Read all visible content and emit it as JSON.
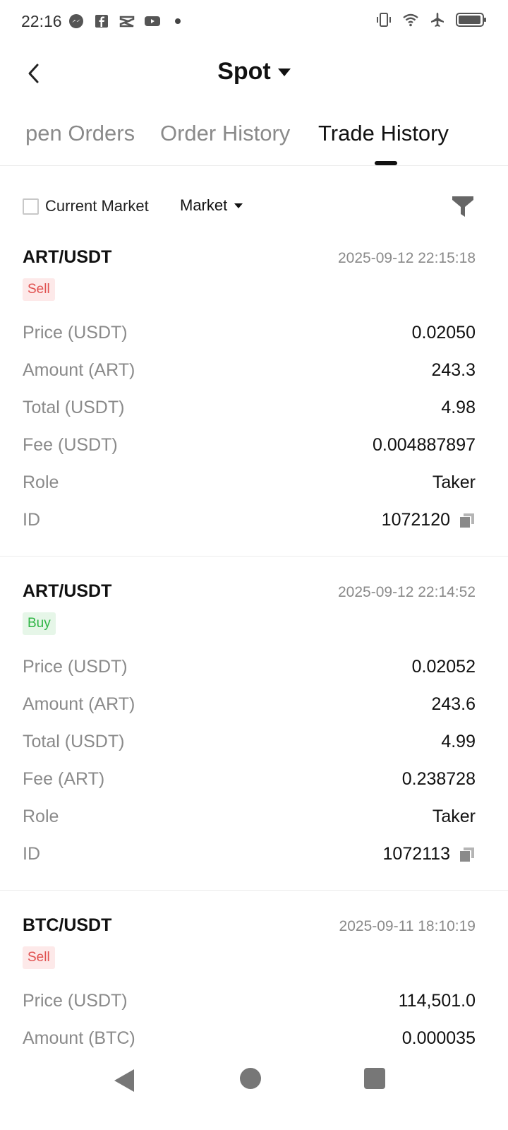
{
  "status_bar": {
    "time": "22:16",
    "left_icons": [
      "messenger-icon",
      "facebook-icon",
      "capcut-icon",
      "youtube-icon",
      "notification-dot"
    ],
    "right_icons": [
      "vibrate-icon",
      "wifi-icon",
      "airplane-icon",
      "battery-icon"
    ]
  },
  "header": {
    "title": "Spot"
  },
  "tabs": [
    {
      "label": "Open Orders",
      "visible_text": "pen Orders",
      "active": false
    },
    {
      "label": "Order History",
      "active": false
    },
    {
      "label": "Trade History",
      "active": true
    }
  ],
  "filters": {
    "current_market_label": "Current Market",
    "current_market_checked": false,
    "market_dropdown_label": "Market"
  },
  "trades": [
    {
      "pair": "ART/USDT",
      "time": "2025-09-12 22:15:18",
      "side": "Sell",
      "rows": [
        {
          "label": "Price (USDT)",
          "value": "0.02050"
        },
        {
          "label": "Amount (ART)",
          "value": "243.3"
        },
        {
          "label": "Total (USDT)",
          "value": "4.98"
        },
        {
          "label": "Fee (USDT)",
          "value": "0.004887897"
        },
        {
          "label": "Role",
          "value": "Taker"
        },
        {
          "label": "ID",
          "value": "1072120"
        }
      ]
    },
    {
      "pair": "ART/USDT",
      "time": "2025-09-12 22:14:52",
      "side": "Buy",
      "rows": [
        {
          "label": "Price (USDT)",
          "value": "0.02052"
        },
        {
          "label": "Amount (ART)",
          "value": "243.6"
        },
        {
          "label": "Total (USDT)",
          "value": "4.99"
        },
        {
          "label": "Fee (ART)",
          "value": "0.238728"
        },
        {
          "label": "Role",
          "value": "Taker"
        },
        {
          "label": "ID",
          "value": "1072113"
        }
      ]
    },
    {
      "pair": "BTC/USDT",
      "time": "2025-09-11 18:10:19",
      "side": "Sell",
      "rows": [
        {
          "label": "Price (USDT)",
          "value": "114,501.0"
        },
        {
          "label": "Amount (BTC)",
          "value": "0.000035"
        }
      ]
    }
  ],
  "colors": {
    "sell": "#e0504f",
    "sell_bg": "#fde9e9",
    "buy": "#2fb545",
    "buy_bg": "#e6f6e8",
    "muted": "#8a8a8a",
    "text": "#111111"
  }
}
